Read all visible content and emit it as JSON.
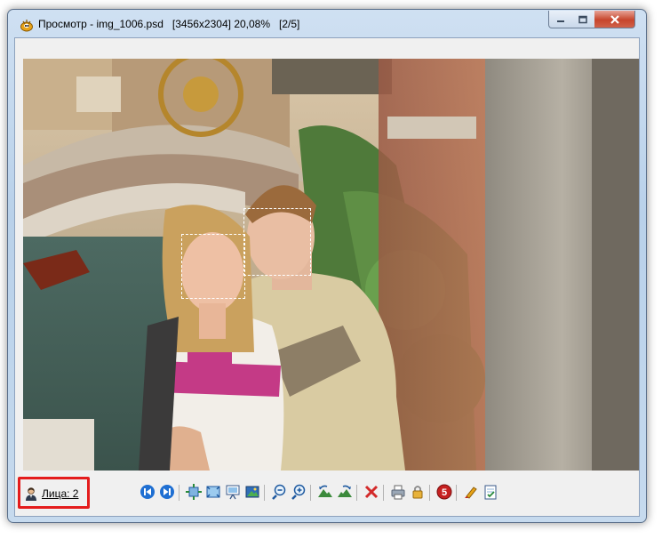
{
  "window": {
    "title_app": "Просмотр",
    "title_separator": "-",
    "file_name": "img_1006.psd",
    "dimensions": "[3456x2304]",
    "zoom": "20,08%",
    "position": "[2/5]"
  },
  "faces": {
    "label": "Лица: 2",
    "count": 2
  },
  "toolbar": [
    {
      "name": "first-image-button",
      "icon": "skip-back-icon"
    },
    {
      "name": "next-image-button",
      "icon": "skip-forward-icon"
    },
    {
      "name": "fit-window-button",
      "icon": "fit-window-icon"
    },
    {
      "name": "actual-size-button",
      "icon": "actual-size-icon"
    },
    {
      "name": "slideshow-button",
      "icon": "slideshow-icon"
    },
    {
      "name": "set-wallpaper-button",
      "icon": "picture-icon"
    },
    {
      "name": "zoom-out-button",
      "icon": "zoom-out-icon"
    },
    {
      "name": "zoom-in-button",
      "icon": "zoom-in-icon"
    },
    {
      "name": "rotate-left-button",
      "icon": "rotate-left-icon"
    },
    {
      "name": "rotate-right-button",
      "icon": "rotate-right-icon"
    },
    {
      "name": "delete-button",
      "icon": "delete-icon"
    },
    {
      "name": "print-button",
      "icon": "print-icon"
    },
    {
      "name": "lock-button",
      "icon": "lock-icon"
    },
    {
      "name": "rating-button",
      "icon": "rating-5-icon",
      "text": "5"
    },
    {
      "name": "edit-button",
      "icon": "brush-icon"
    },
    {
      "name": "properties-button",
      "icon": "document-check-icon"
    }
  ],
  "colors": {
    "highlight": "#e41c1c",
    "accent_blue": "#1f6fd2",
    "delete_red": "#d32a2a",
    "face_box": "#ffffff"
  }
}
